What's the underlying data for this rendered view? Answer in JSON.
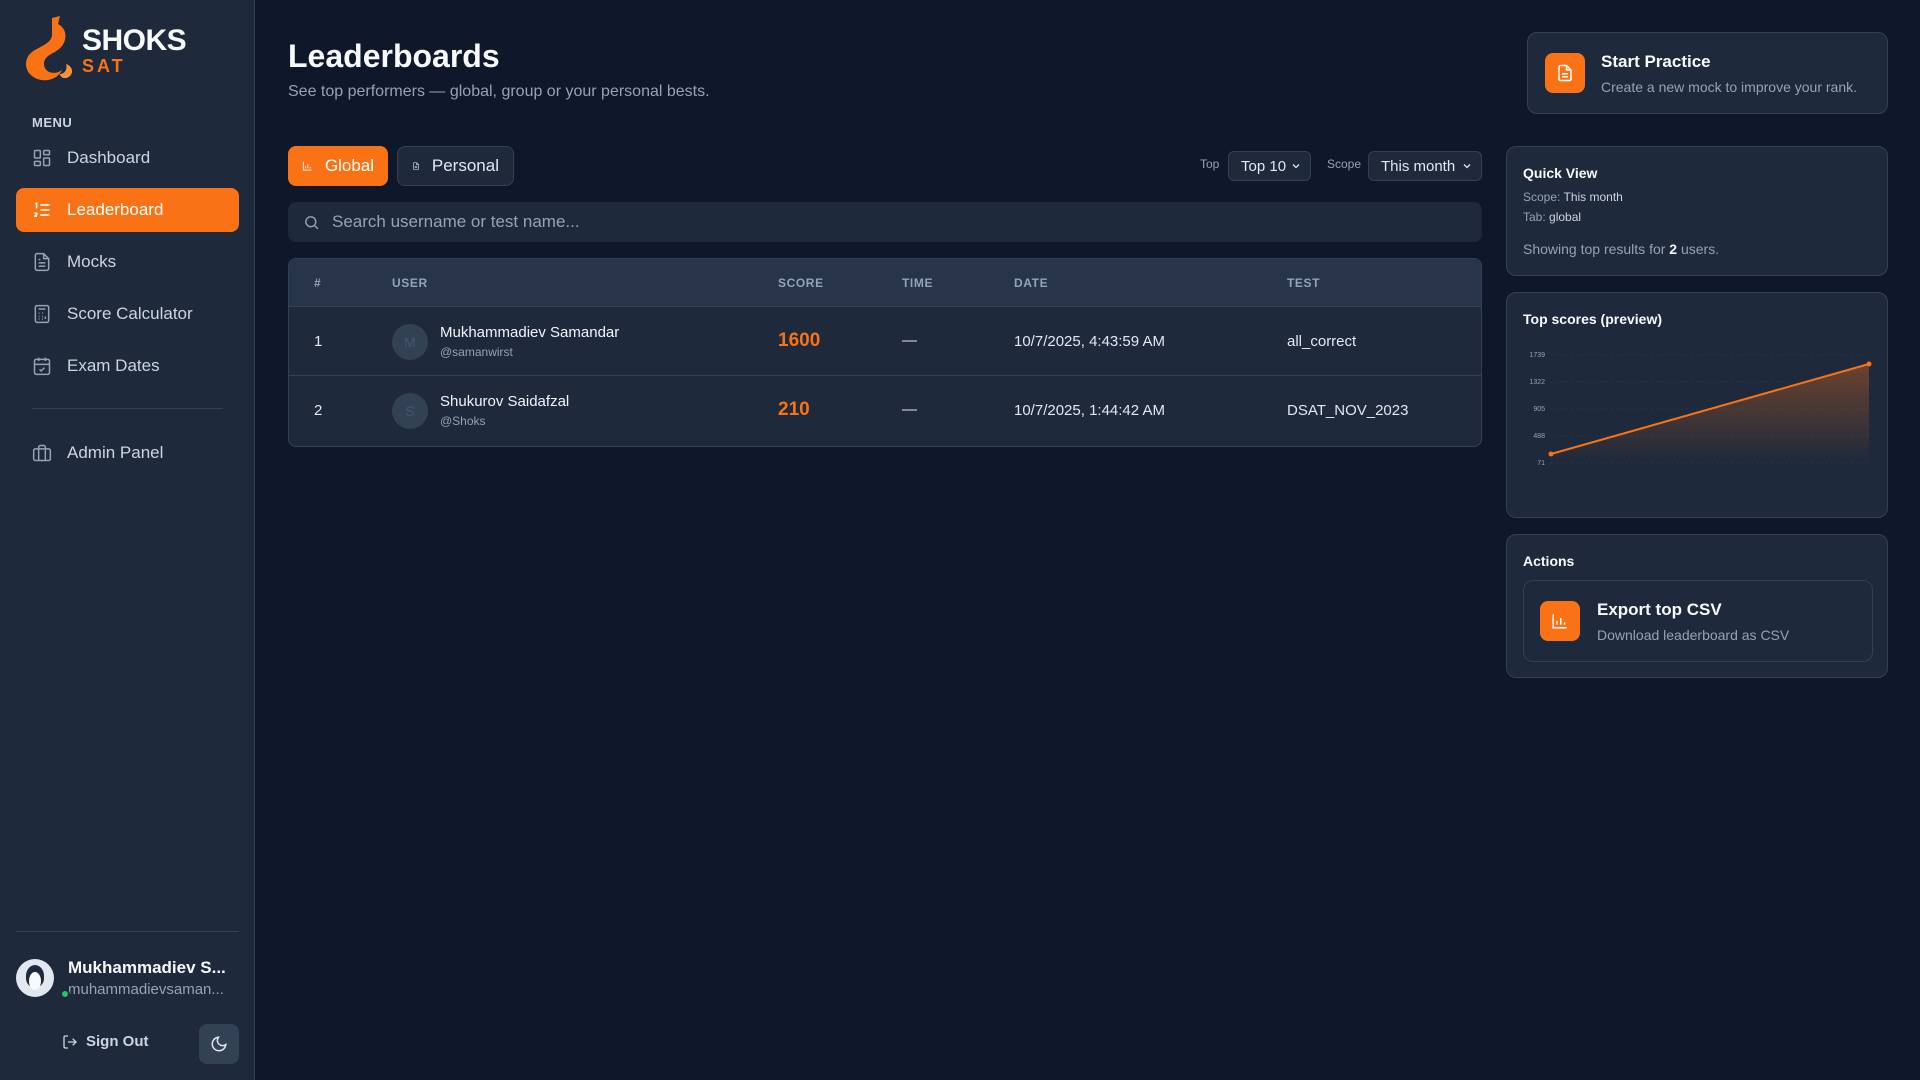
{
  "brand": {
    "title": "SHOKS",
    "subtitle": "SAT"
  },
  "sidebar": {
    "menu_label": "MENU",
    "items": [
      {
        "label": "Dashboard",
        "icon": "dashboard-icon",
        "active": false
      },
      {
        "label": "Leaderboard",
        "icon": "list-icon",
        "active": true
      },
      {
        "label": "Mocks",
        "icon": "document-icon",
        "active": false
      },
      {
        "label": "Score Calculator",
        "icon": "calculator-icon",
        "active": false
      },
      {
        "label": "Exam Dates",
        "icon": "calendar-icon",
        "active": false
      },
      {
        "label": "Admin Panel",
        "icon": "briefcase-icon",
        "active": false
      }
    ],
    "user": {
      "name": "Mukhammadiev S...",
      "email": "muhammadievsaman..."
    },
    "sign_out": "Sign Out"
  },
  "header": {
    "title": "Leaderboards",
    "subtitle": "See top performers — global, group or your personal bests."
  },
  "tabs": {
    "global": "Global",
    "personal": "Personal"
  },
  "filters": {
    "top_label": "Top",
    "top_value": "Top 10",
    "scope_label": "Scope",
    "scope_value": "This month"
  },
  "search": {
    "placeholder": "Search username or test name..."
  },
  "table": {
    "headers": {
      "rank": "#",
      "user": "USER",
      "score": "SCORE",
      "time": "TIME",
      "date": "DATE",
      "test": "TEST"
    },
    "rows": [
      {
        "rank": "1",
        "initial": "M",
        "name": "Mukhammadiev Samandar",
        "handle": "@samanwirst",
        "score": "1600",
        "time": "—",
        "date": "10/7/2025, 4:43:59 AM",
        "test": "all_correct"
      },
      {
        "rank": "2",
        "initial": "S",
        "name": "Shukurov Saidafzal",
        "handle": "@Shoks",
        "score": "210",
        "time": "—",
        "date": "10/7/2025, 1:44:42 AM",
        "test": "DSAT_NOV_2023"
      }
    ]
  },
  "start_practice": {
    "title": "Start Practice",
    "subtitle": "Create a new mock to improve your rank."
  },
  "quick_view": {
    "title": "Quick View",
    "scope_label": "Scope:",
    "scope_value": "This month",
    "tab_label": "Tab:",
    "tab_value": "global",
    "showing_prefix": "Showing top results for",
    "showing_count": "2",
    "showing_suffix": "users."
  },
  "top_scores": {
    "title": "Top scores (preview)"
  },
  "actions": {
    "title": "Actions",
    "export_title": "Export top CSV",
    "export_subtitle": "Download leaderboard as CSV"
  },
  "colors": {
    "accent": "#f97316",
    "background": "#0f172a",
    "panel": "#1e293b"
  },
  "chart_data": {
    "type": "area",
    "title": "Top scores (preview)",
    "x": [
      1,
      2
    ],
    "series": [
      {
        "values": [
          210,
          1600
        ]
      }
    ],
    "y_ticks": [
      "1739",
      "1322",
      "905",
      "488",
      "71"
    ],
    "ylim": [
      71,
      1739
    ]
  }
}
